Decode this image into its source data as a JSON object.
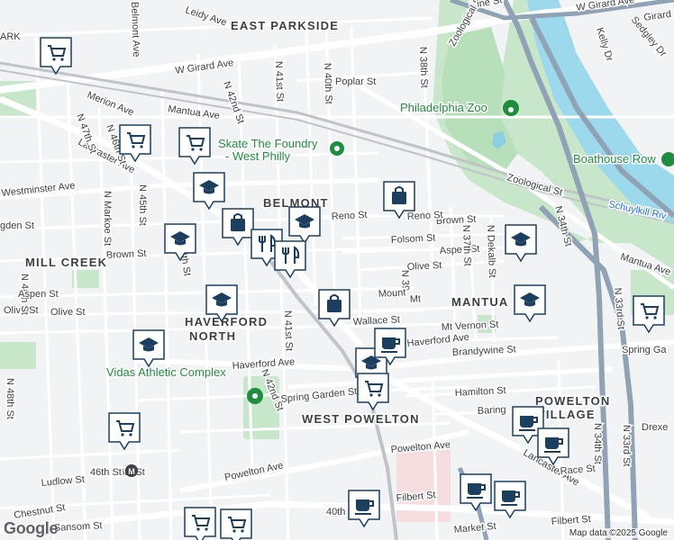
{
  "map": {
    "attribution": "Map data ©2025 Google",
    "logo": "Google",
    "neighborhoods": [
      {
        "name": "EAST PARKSIDE"
      },
      {
        "name": "BELMONT"
      },
      {
        "name": "MILL CREEK"
      },
      {
        "name": "HAVERFORD"
      },
      {
        "name": "NORTH"
      },
      {
        "name": "MANTUA"
      },
      {
        "name": "POWELTON"
      },
      {
        "name": "VILLAGE"
      },
      {
        "name": "WEST POWELTON"
      }
    ],
    "pois": [
      {
        "name": "Philadelphia Zoo",
        "icon": "paw-icon"
      },
      {
        "name": "Skate The Foundry",
        "icon": "pin-icon"
      },
      {
        "name": "- West Philly",
        "icon": ""
      },
      {
        "name": "Boathouse Row",
        "icon": "pin-icon"
      },
      {
        "name": "Vidas Athletic Complex",
        "icon": "pin-icon"
      },
      {
        "name": "Schuylkill Riv",
        "icon": ""
      },
      {
        "name": "Drexe",
        "icon": ""
      }
    ],
    "streets": [
      "W Girard Ave",
      "W Girard Ave",
      "Mantua Ave",
      "Poplar St",
      "Westminster Ave",
      "Lancaster Ave",
      "Reno St",
      "Brown St",
      "Folsom St",
      "Aspen St",
      "Olive St",
      "Mt Vernon St",
      "Wallace St",
      "Haverford Ave",
      "Haverford Ave",
      "Brandywine St",
      "Spring Garden St",
      "Hamilton St",
      "Powelton Ave",
      "Powelton Ave",
      "Lancaster Ave",
      "Race St",
      "Filbert St",
      "Filbert St",
      "Chestnut St",
      "Ludlow St",
      "Sansom St",
      "Market St",
      "N 48th St",
      "N 48th St",
      "N 47th St",
      "N 46th St",
      "N 45th St",
      "N 44th St",
      "N 42nd St",
      "N 42nd St",
      "N 41st St",
      "N 41st St",
      "N 40th St",
      "N 38th St",
      "N 39",
      "N 37th St",
      "N Dekalb St",
      "N 34th St",
      "N 33rd St",
      "N 34th St",
      "N 33rd St",
      "Zoological St",
      "Zoological St",
      "Kelly Dr",
      "Sedgley Dr",
      "Merion Ave",
      "N Markoe St",
      "Belmont Ave",
      "Leidy Ave",
      "Mantua Ave",
      "Spring Ga",
      "Baring",
      "46th St",
      "40th",
      "Aspen St",
      "Olive St",
      "Olive St",
      "Reno St",
      "gden St",
      "Mount",
      "Mt",
      "Brown St",
      "Girard Ave",
      "ARK",
      "ine St"
    ],
    "transit": [
      "46th St"
    ],
    "markers": [
      {
        "type": "grocery"
      },
      {
        "type": "grocery"
      },
      {
        "type": "grocery"
      },
      {
        "type": "school"
      },
      {
        "type": "school"
      },
      {
        "type": "school"
      },
      {
        "type": "school"
      },
      {
        "type": "school"
      },
      {
        "type": "school"
      },
      {
        "type": "school"
      },
      {
        "type": "school"
      },
      {
        "type": "shopping"
      },
      {
        "type": "shopping"
      },
      {
        "type": "shopping"
      },
      {
        "type": "cafe"
      },
      {
        "type": "cafe"
      },
      {
        "type": "cafe"
      },
      {
        "type": "cafe"
      },
      {
        "type": "cafe"
      },
      {
        "type": "cafe"
      },
      {
        "type": "grocery"
      },
      {
        "type": "grocery"
      },
      {
        "type": "grocery"
      },
      {
        "type": "grocery"
      },
      {
        "type": "restaurant"
      },
      {
        "type": "restaurant"
      },
      {
        "type": "grocery"
      }
    ],
    "colors": {
      "background": "#f2f3f5",
      "park": "#c8e6c9",
      "zoo_park": "#b7dfb9",
      "water": "#9cd9ed",
      "highway": "#8fa3b5",
      "marker": "#1c3f5f",
      "marker_fill": "#ffffff",
      "rail": "#c0c4c8"
    }
  }
}
